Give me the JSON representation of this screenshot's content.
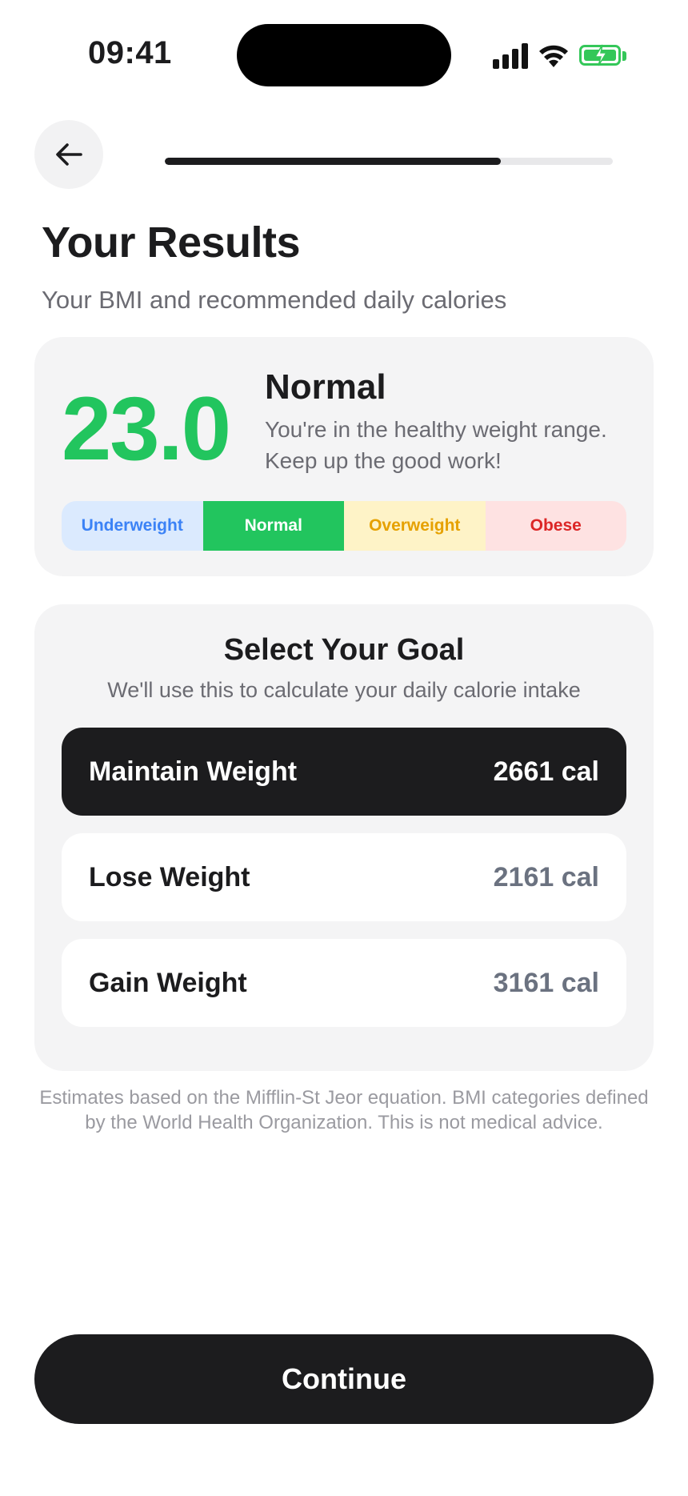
{
  "status_bar": {
    "time": "09:41",
    "icons": [
      "signal-icon",
      "wifi-icon",
      "battery-charging-icon"
    ]
  },
  "nav": {
    "back_icon": "arrow-left-icon",
    "progress_fraction": 0.75
  },
  "header": {
    "title": "Your Results",
    "subtitle": "Your BMI and recommended daily calories"
  },
  "bmi": {
    "value": "23.0",
    "category": "Normal",
    "description": "You're in the healthy weight range. Keep up the good work!",
    "scale": [
      "Underweight",
      "Normal",
      "Overweight",
      "Obese"
    ],
    "active_segment": "Normal",
    "colors": {
      "value": "#22c55e",
      "underweight": "#3b82f6",
      "normal": "#22c55e",
      "overweight": "#e6a100",
      "obese": "#dc2626"
    }
  },
  "goal": {
    "title": "Select Your Goal",
    "subtitle": "We'll use this to calculate your daily calorie intake",
    "options": [
      {
        "label": "Maintain Weight",
        "calories": "2661 cal",
        "selected": true
      },
      {
        "label": "Lose Weight",
        "calories": "2161 cal",
        "selected": false
      },
      {
        "label": "Gain Weight",
        "calories": "3161 cal",
        "selected": false
      }
    ]
  },
  "disclaimer": "Estimates based on the Mifflin-St Jeor equation. BMI categories defined by the World Health Organization. This is not medical advice.",
  "continue_label": "Continue"
}
